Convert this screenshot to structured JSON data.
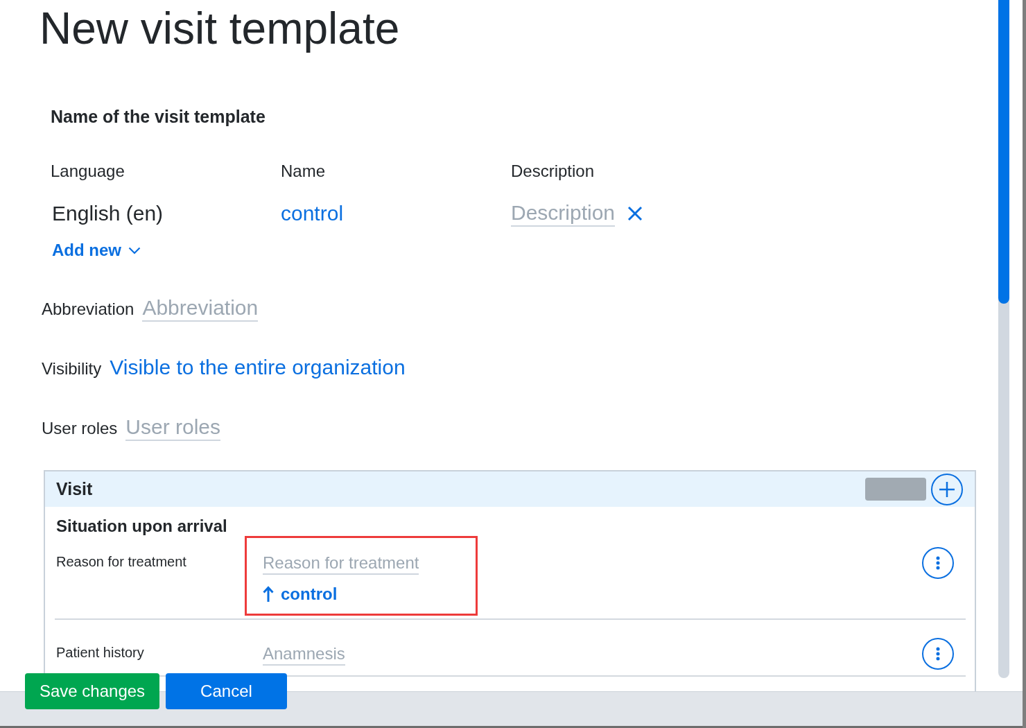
{
  "page": {
    "title": "New visit template"
  },
  "name_section": {
    "heading": "Name of the visit template",
    "columns": [
      "Language",
      "Name",
      "Description"
    ],
    "rows": [
      {
        "language": "English (en)",
        "name": "control",
        "description": {
          "placeholder": "Description"
        }
      }
    ],
    "add_button": "Add new"
  },
  "fields": [
    {
      "kind": "input",
      "label": "Abbreviation",
      "placeholder": "Abbreviation"
    },
    {
      "kind": "link",
      "label": "Visibility",
      "value": "Visible to the entire organization"
    },
    {
      "kind": "input",
      "label": "User roles",
      "placeholder": "User roles"
    }
  ],
  "visit_panel": {
    "title": "Visit",
    "group_title": "Situation upon arrival",
    "rows": [
      {
        "label": "Reason for treatment",
        "placeholder": "Reason for treatment",
        "linked_value": "control",
        "highlighted": true
      },
      {
        "label": "Patient history",
        "placeholder": "Anamnesis",
        "highlighted": false
      }
    ]
  },
  "footer": {
    "buttons": [
      {
        "kind": "confirm",
        "label": "Save changes"
      },
      {
        "kind": "cancel",
        "label": "Cancel"
      }
    ]
  }
}
